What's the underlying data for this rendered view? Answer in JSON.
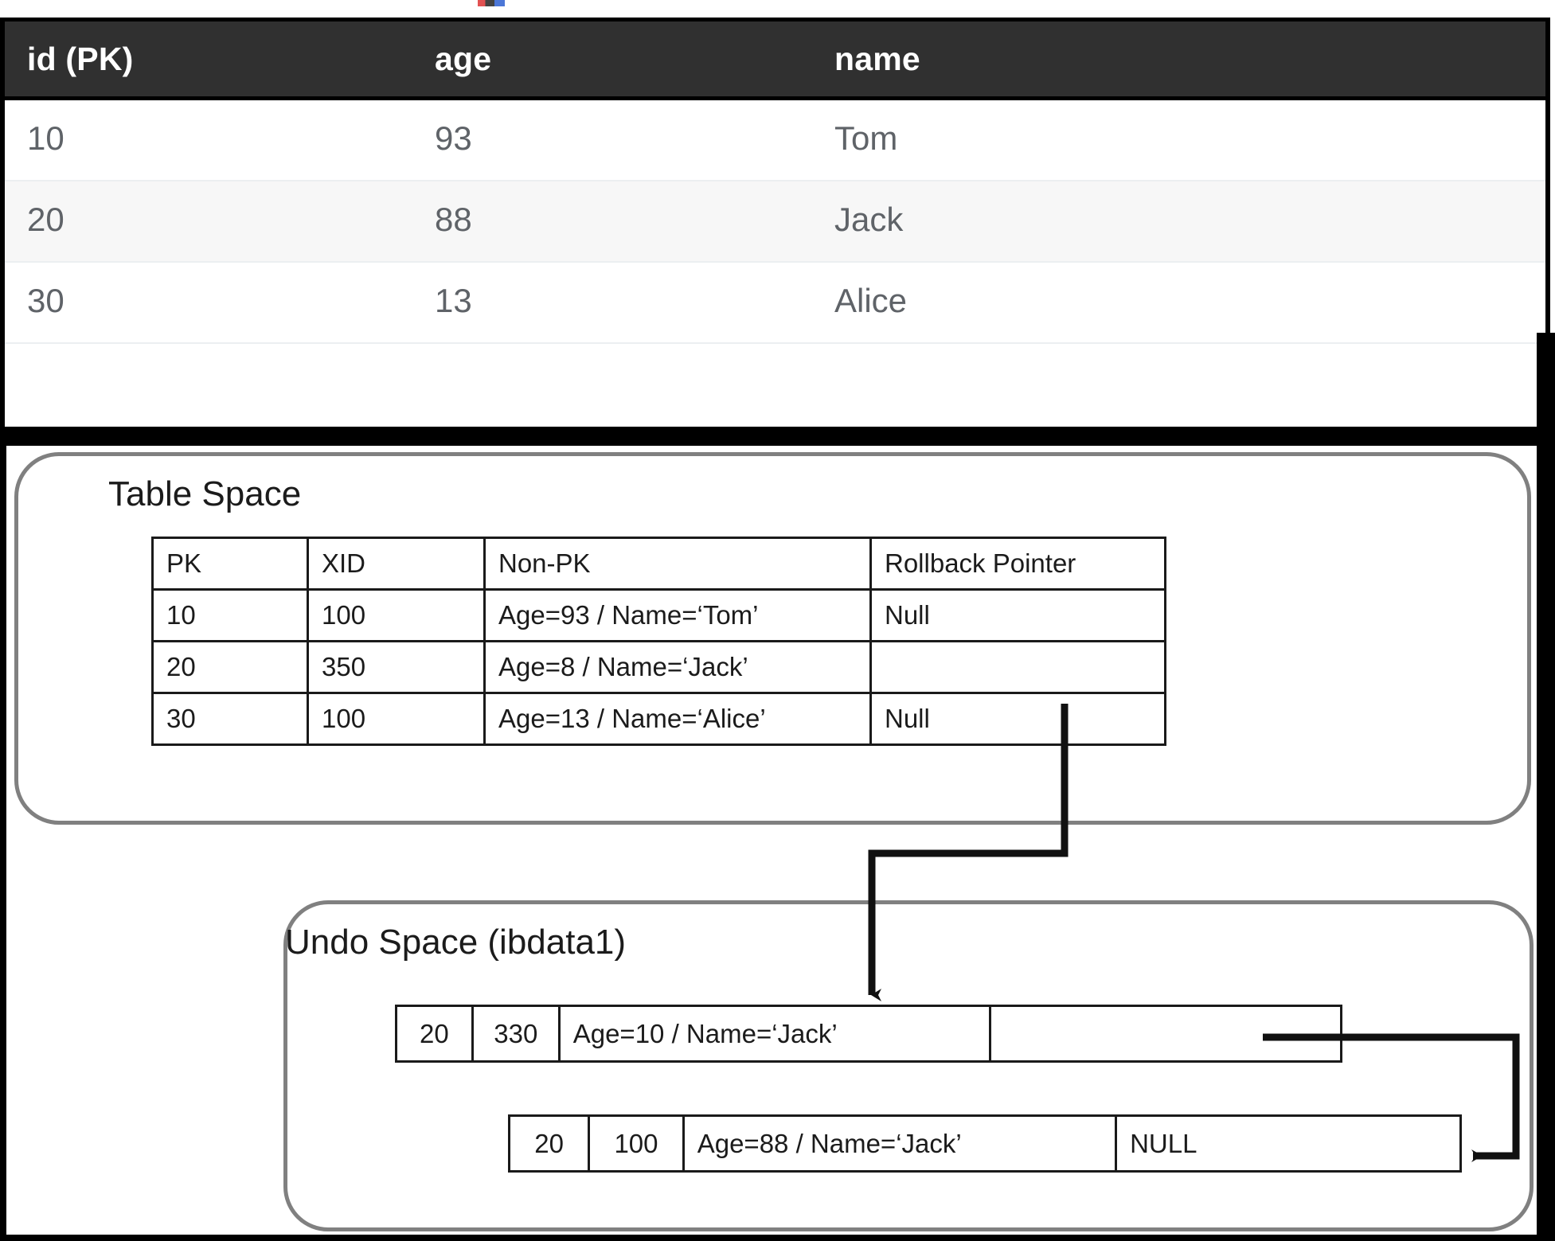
{
  "result_grid": {
    "columns": [
      "id (PK)",
      "age",
      "name"
    ],
    "rows": [
      {
        "id": "10",
        "age": "93",
        "name": "Tom"
      },
      {
        "id": "20",
        "age": "88",
        "name": "Jack"
      },
      {
        "id": "30",
        "age": "13",
        "name": "Alice"
      }
    ]
  },
  "table_space": {
    "title": "Table Space",
    "columns": [
      "PK",
      "XID",
      "Non-PK",
      "Rollback Pointer"
    ],
    "rows": [
      {
        "pk": "10",
        "xid": "100",
        "non_pk": "Age=93 / Name=‘Tom’",
        "rollback": "Null"
      },
      {
        "pk": "20",
        "xid": "350",
        "non_pk": "Age=8   / Name=‘Jack’",
        "rollback": ""
      },
      {
        "pk": "30",
        "xid": "100",
        "non_pk": "Age=13 / Name=‘Alice’",
        "rollback": "Null"
      }
    ]
  },
  "undo_space": {
    "title": "Undo Space (ibdata1)",
    "records": [
      {
        "pk": "20",
        "xid": "330",
        "non_pk": "Age=10   / Name=‘Jack’",
        "rollback": ""
      },
      {
        "pk": "20",
        "xid": "100",
        "non_pk": "Age=88   / Name=‘Jack’",
        "rollback": "NULL"
      }
    ]
  },
  "connectors": [
    {
      "name": "tablespace-row20-to-undo-rec1",
      "from": "table_space.rows.1.rollback",
      "to": "undo_space.records.0"
    },
    {
      "name": "undo-rec1-to-undo-rec2",
      "from": "undo_space.records.0.rollback",
      "to": "undo_space.records.1"
    }
  ],
  "colors": {
    "header_bg": "#303030",
    "header_fg": "#ffffff",
    "cell_fg": "#5f6368",
    "alt_row_bg": "#f7f7f7",
    "frame": "#000000",
    "space_border": "#808080",
    "rule": "#1a1a1a"
  }
}
